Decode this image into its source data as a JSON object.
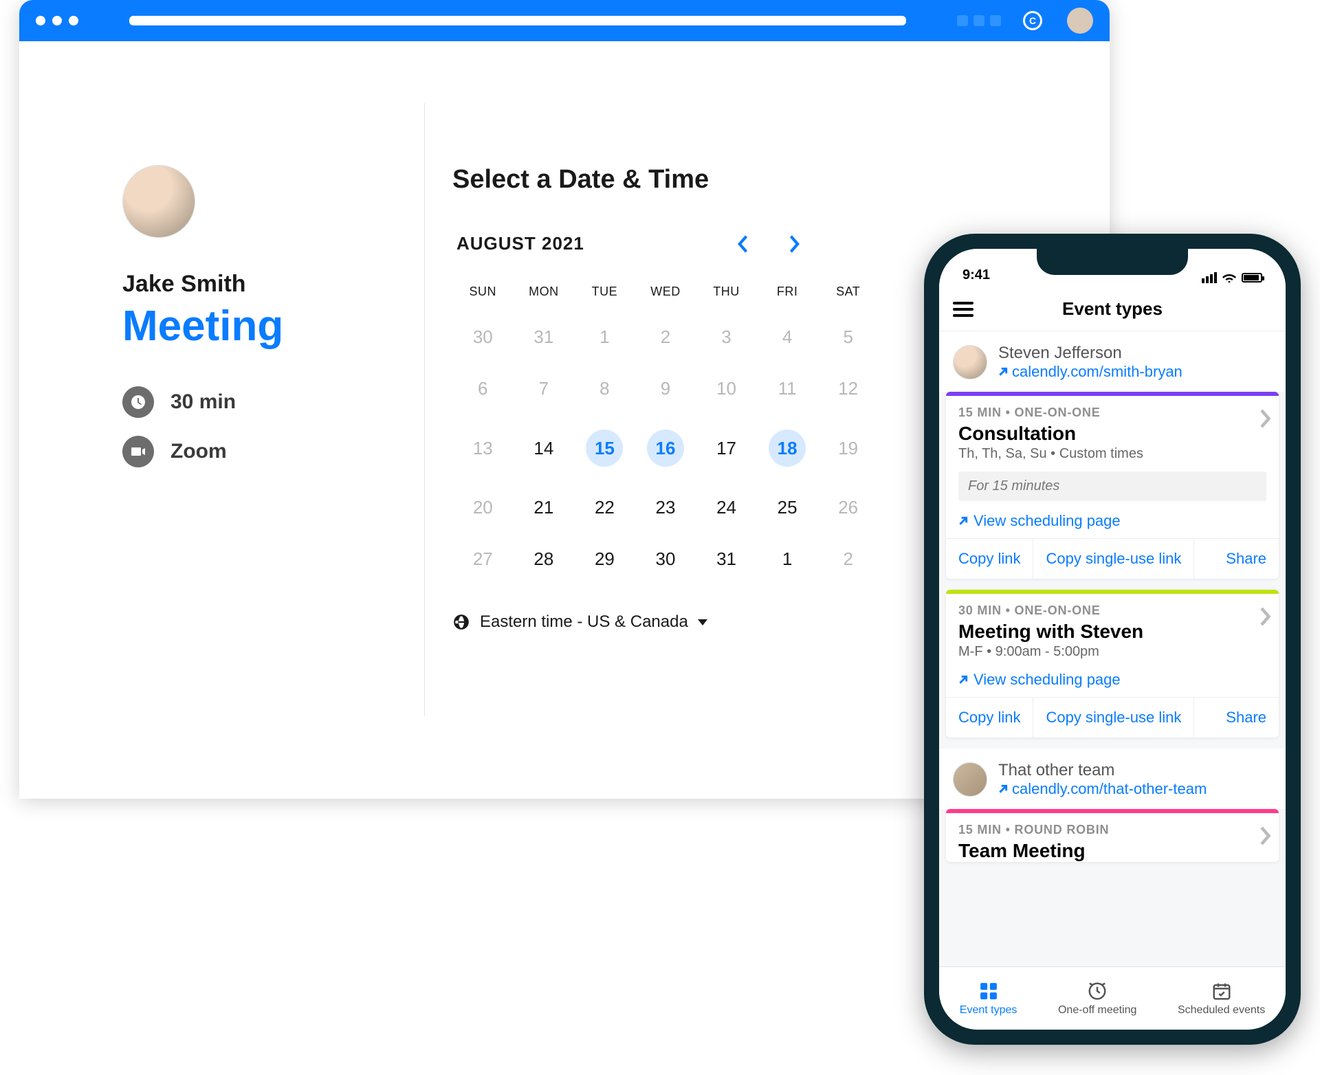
{
  "browser": {
    "host_name": "Jake Smith",
    "meeting_title": "Meeting",
    "duration_label": "30 min",
    "location_label": "Zoom",
    "heading": "Select a Date & Time",
    "month_label": "AUGUST 2021",
    "weekdays": [
      "SUN",
      "MON",
      "TUE",
      "WED",
      "THU",
      "FRI",
      "SAT"
    ],
    "weeks": [
      [
        {
          "d": "30",
          "dim": true
        },
        {
          "d": "31",
          "dim": true
        },
        {
          "d": "1",
          "dim": true
        },
        {
          "d": "2",
          "dim": true
        },
        {
          "d": "3",
          "dim": true
        },
        {
          "d": "4",
          "dim": true
        },
        {
          "d": "5",
          "dim": true
        }
      ],
      [
        {
          "d": "6",
          "dim": true
        },
        {
          "d": "7",
          "dim": true
        },
        {
          "d": "8",
          "dim": true
        },
        {
          "d": "9",
          "dim": true
        },
        {
          "d": "10",
          "dim": true
        },
        {
          "d": "11",
          "dim": true
        },
        {
          "d": "12",
          "dim": true
        }
      ],
      [
        {
          "d": "13",
          "dim": true
        },
        {
          "d": "14"
        },
        {
          "d": "15",
          "avail": true
        },
        {
          "d": "16",
          "avail": true
        },
        {
          "d": "17"
        },
        {
          "d": "18",
          "avail": true
        },
        {
          "d": "19",
          "dim": true
        }
      ],
      [
        {
          "d": "20",
          "dim": true
        },
        {
          "d": "21"
        },
        {
          "d": "22"
        },
        {
          "d": "23"
        },
        {
          "d": "24"
        },
        {
          "d": "25"
        },
        {
          "d": "26",
          "dim": true
        }
      ],
      [
        {
          "d": "27",
          "dim": true
        },
        {
          "d": "28"
        },
        {
          "d": "29"
        },
        {
          "d": "30"
        },
        {
          "d": "31"
        },
        {
          "d": "1"
        },
        {
          "d": "2",
          "dim": true
        }
      ]
    ],
    "timezone_label": "Eastern time - US & Canada"
  },
  "phone": {
    "time": "9:41",
    "screen_title": "Event types",
    "user1": {
      "name": "Steven Jefferson",
      "url": "calendly.com/smith-bryan"
    },
    "user2": {
      "name": "That other team",
      "url": "calendly.com/that-other-team"
    },
    "cards": [
      {
        "stripe": "purple",
        "meta": "15 MIN • ONE-ON-ONE",
        "title": "Consultation",
        "sub": "Th, Th, Sa, Su • Custom times",
        "desc": "For 15 minutes",
        "view": "View scheduling page",
        "copy": "Copy link",
        "single": "Copy single-use link",
        "share": "Share"
      },
      {
        "stripe": "lime",
        "meta": "30 MIN • ONE-ON-ONE",
        "title": "Meeting with Steven",
        "sub": "M-F • 9:00am - 5:00pm",
        "view": "View scheduling page",
        "copy": "Copy link",
        "single": "Copy single-use link",
        "share": "Share"
      },
      {
        "stripe": "pink",
        "meta": "15 MIN • ROUND ROBIN",
        "title": "Team Meeting"
      }
    ],
    "tabs": {
      "event_types": "Event types",
      "one_off": "One-off meeting",
      "scheduled": "Scheduled events"
    }
  }
}
